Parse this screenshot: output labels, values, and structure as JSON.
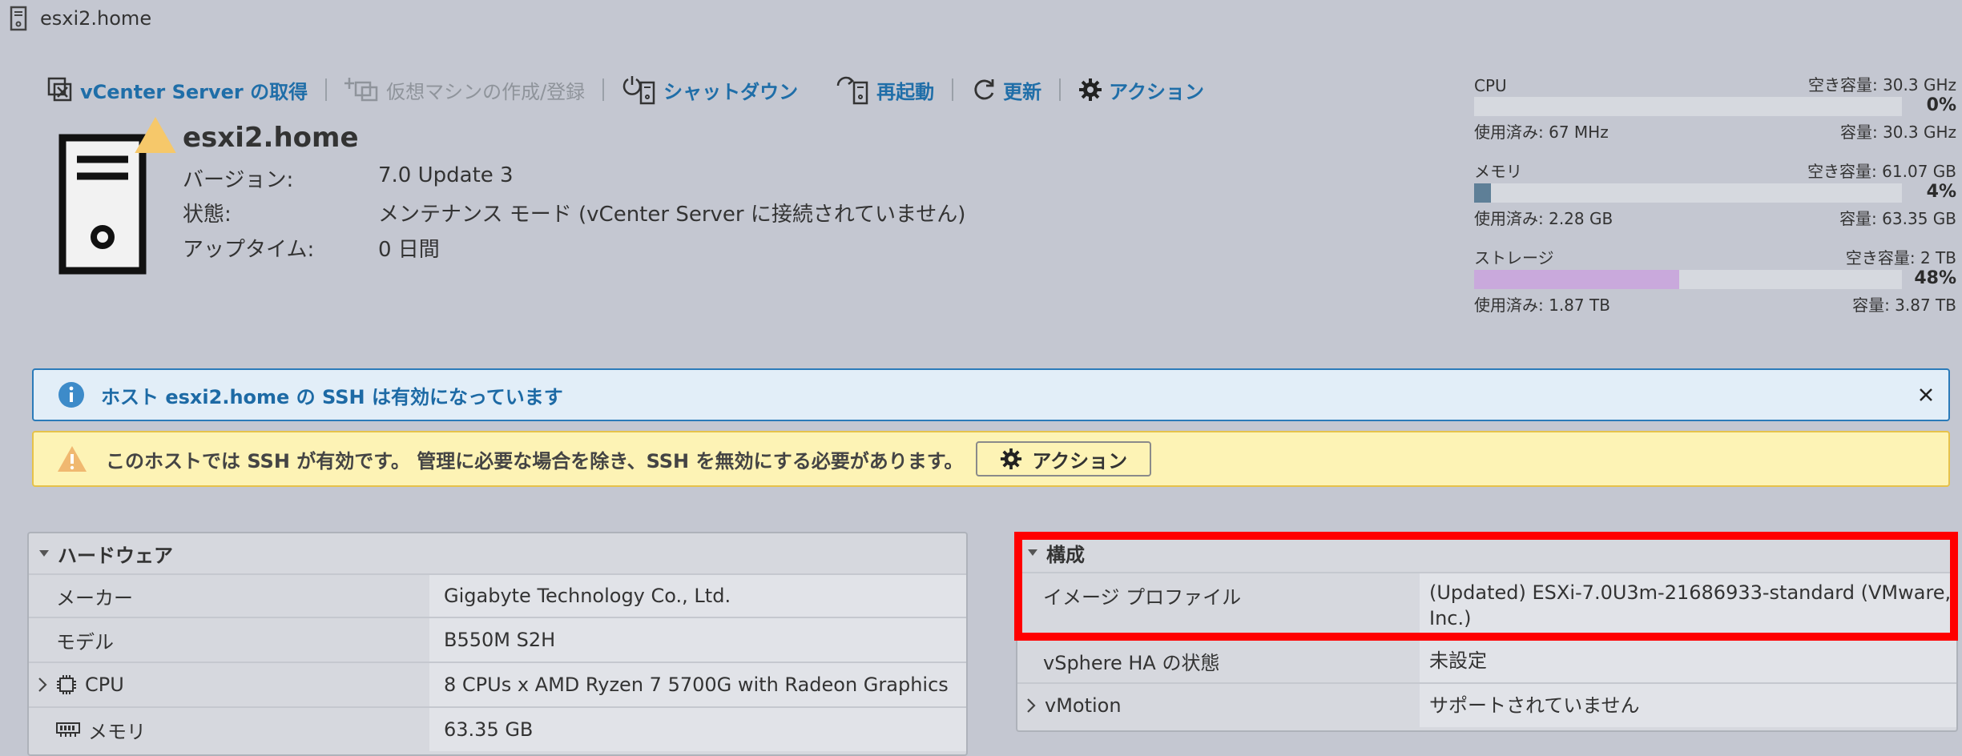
{
  "window": {
    "title": "esxi2.home"
  },
  "toolbar": {
    "vcenter": "vCenter Server の取得",
    "create_vm": "仮想マシンの作成/登録",
    "shutdown": "シャットダウン",
    "reboot": "再起動",
    "refresh": "更新",
    "actions": "アクション"
  },
  "host": {
    "name": "esxi2.home",
    "version_label": "バージョン:",
    "version_value": "7.0 Update 3",
    "state_label": "状態:",
    "state_value": "メンテナンス モード (vCenter Server に接続されていません)",
    "uptime_label": "アップタイム:",
    "uptime_value": "0 日間"
  },
  "resources": {
    "cpu": {
      "label": "CPU",
      "free": "空き容量: 30.3 GHz",
      "percent": "0%",
      "percent_value": 0,
      "used": "使用済み: 67 MHz",
      "capacity": "容量: 30.3 GHz",
      "color": "#5b7fa0"
    },
    "memory": {
      "label": "メモリ",
      "free": "空き容量: 61.07 GB",
      "percent": "4%",
      "percent_value": 4,
      "used": "使用済み: 2.28 GB",
      "capacity": "容量: 63.35 GB",
      "color": "#5e7f97"
    },
    "storage": {
      "label": "ストレージ",
      "free": "空き容量: 2 TB",
      "percent": "48%",
      "percent_value": 48,
      "used": "使用済み: 1.87 TB",
      "capacity": "容量: 3.87 TB",
      "color": "#c9a9dc"
    }
  },
  "alerts": {
    "info": "ホスト esxi2.home の SSH は有効になっています",
    "warning": "このホストでは SSH が有効です。 管理に必要な場合を除き、SSH を無効にする必要があります。",
    "warning_action": "アクション"
  },
  "hardware": {
    "title": "ハードウェア",
    "rows": [
      {
        "key": "メーカー",
        "value": "Gigabyte Technology Co., Ltd."
      },
      {
        "key": "モデル",
        "value": "B550M S2H"
      },
      {
        "key": "CPU",
        "value": "8 CPUs x AMD Ryzen 7 5700G with Radeon Graphics"
      },
      {
        "key": "メモリ",
        "value": "63.35 GB"
      }
    ]
  },
  "configuration": {
    "title": "構成",
    "rows": [
      {
        "key": "イメージ プロファイル",
        "value": "(Updated) ESXi-7.0U3m-21686933-standard (VMware, Inc.)"
      },
      {
        "key": "vSphere HA の状態",
        "value": "未設定"
      },
      {
        "key": "vMotion",
        "value": "サポートされていません"
      }
    ]
  }
}
